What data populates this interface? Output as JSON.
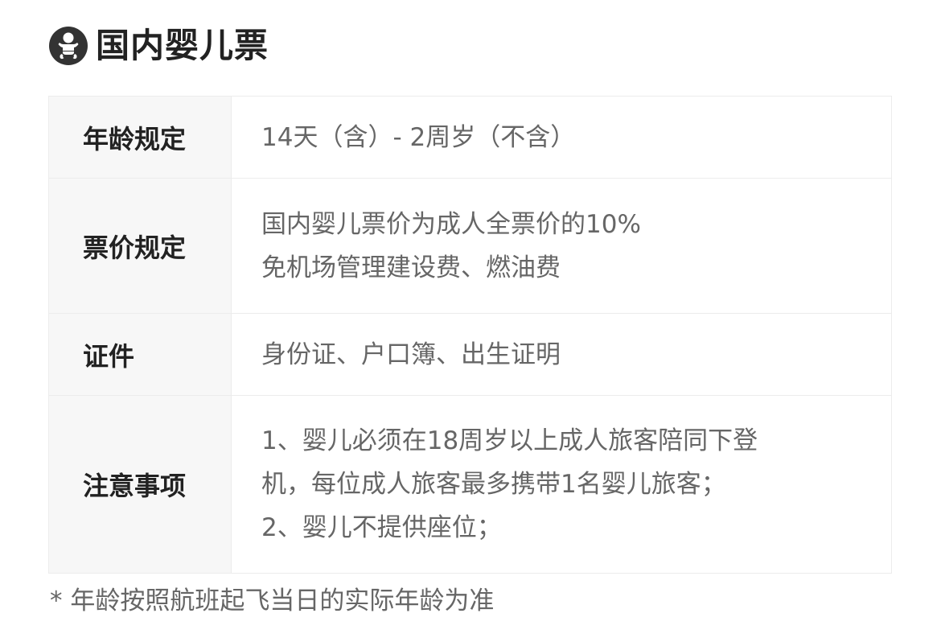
{
  "header": {
    "icon": "baby-icon",
    "title": "国内婴儿票"
  },
  "table": {
    "rows": [
      {
        "label": "年龄规定",
        "lines": [
          "14天（含）- 2周岁（不含）"
        ]
      },
      {
        "label": "票价规定",
        "lines": [
          "国内婴儿票价为成人全票价的10%",
          "免机场管理建设费、燃油费"
        ]
      },
      {
        "label": "证件",
        "lines": [
          "身份证、户口簿、出生证明"
        ]
      },
      {
        "label": "注意事项",
        "lines": [
          "1、婴儿必须在18周岁以上成人旅客陪同下登",
          "机，每位成人旅客最多携带1名婴儿旅客；",
          "2、婴儿不提供座位；"
        ]
      }
    ]
  },
  "footnote": "* 年龄按照航班起飞当日的实际年龄为准",
  "colors": {
    "icon_bg": "#333333",
    "title": "#222222",
    "value_text": "#666666",
    "label_bg": "#f7f7f7",
    "border": "#ececec"
  }
}
